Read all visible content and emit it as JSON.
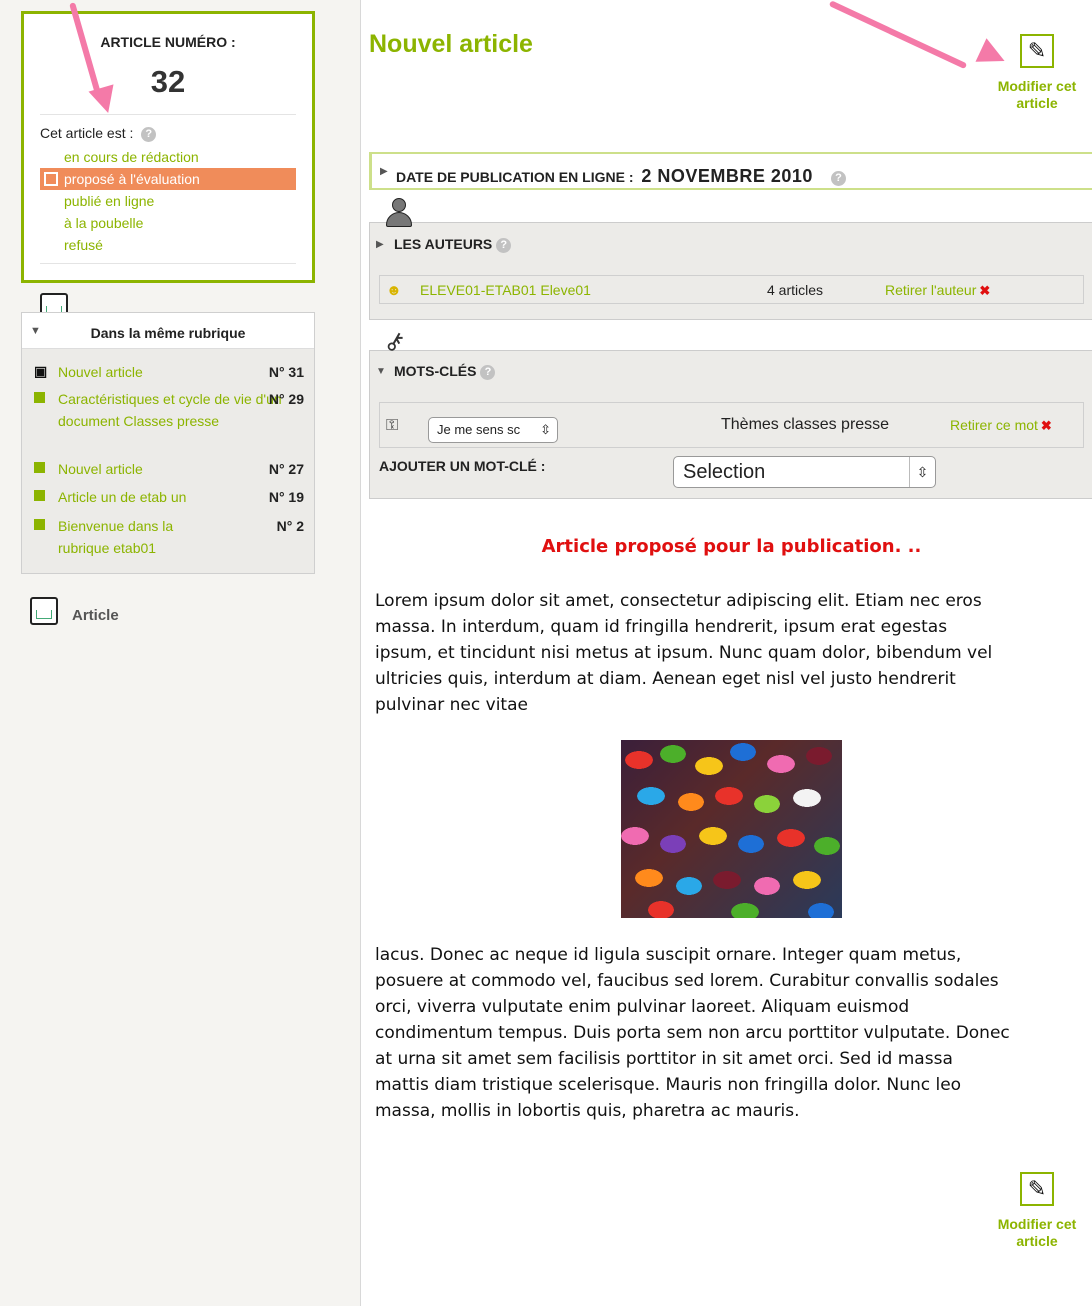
{
  "sidebar": {
    "article_box": {
      "label": "ARTICLE NUMÉRO :",
      "number": "32",
      "status_title": "Cet article est :",
      "help": "?",
      "statuses": [
        "en cours de rédaction",
        "proposé à l'évaluation",
        "publié en ligne",
        "à la poubelle",
        "refusé"
      ]
    },
    "rubrique": {
      "title": "Dans la même rubrique",
      "items": [
        {
          "label": "Nouvel article",
          "num": "N° 31"
        },
        {
          "label": "Caractéristiques et cycle de vie d'un document Classes presse",
          "num": "N° 29"
        },
        {
          "label": "Nouvel article",
          "num": "N° 27"
        },
        {
          "label": "Article un de etab un",
          "num": "N° 19"
        },
        {
          "label": "Bienvenue dans la rubrique etab01",
          "num": "N° 2"
        }
      ]
    },
    "article_link": "Article"
  },
  "main": {
    "title": "Nouvel article",
    "edit_label_1": "Modifier cet",
    "edit_label_2": "article",
    "date": {
      "label": "DATE DE PUBLICATION EN LIGNE :",
      "value": "2 NOVEMBRE 2010"
    },
    "authors": {
      "title": "LES AUTEURS",
      "name": "ELEVE01-ETAB01 Eleve01",
      "count": "4 articles",
      "remove": "Retirer l'auteur"
    },
    "keywords": {
      "title": "MOTS-CLÉS",
      "select_value": "Je me sens sc",
      "theme": "Thèmes classes presse",
      "remove": "Retirer ce mot",
      "add_label": "AJOUTER UN MOT-CLÉ :",
      "add_select": "Selection"
    },
    "proposed": "Article proposé pour la publication. ..",
    "para1": [
      "Lorem ipsum dolor sit amet, consectetur adipiscing elit. Etiam nec eros",
      "massa. In interdum, quam id fringilla hendrerit, ipsum erat egestas",
      "ipsum, et tincidunt nisi metus at ipsum. Nunc quam dolor, bibendum vel",
      "ultricies quis, interdum at diam. Aenean eget nisl vel justo hendrerit",
      "pulvinar nec vitae"
    ],
    "para2": [
      "lacus. Donec ac neque id ligula suscipit ornare. Integer quam metus,",
      "posuere at commodo vel, faucibus sed lorem. Curabitur convallis sodales",
      "orci, viverra vulputate enim pulvinar laoreet. Aliquam euismod",
      "condimentum tempus. Duis porta sem non arcu porttitor vulputate. Donec",
      "at urna sit amet sem facilisis porttitor in sit amet orci. Sed id massa",
      "mattis diam tristique scelerisque. Mauris non fringilla dolor. Nunc leo",
      "massa, mollis in lobortis quis, pharetra ac mauris."
    ]
  },
  "colors": {
    "accent": "#8cb400",
    "active_status": "#f08c5a",
    "alert": "#e01010",
    "annotation_arrow": "#f47aa8"
  },
  "icons": [
    "help-icon",
    "document-icon",
    "person-icon",
    "key-icon",
    "edit-icon",
    "remove-x-icon"
  ]
}
